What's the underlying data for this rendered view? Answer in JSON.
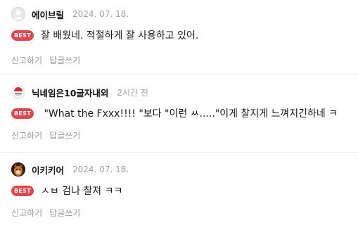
{
  "comments": [
    {
      "author": "에이브릴",
      "date": "2024. 07. 18.",
      "badge": "BEST",
      "text": "잘 배웠네. 적절하게 잘 사용하고 있어.",
      "actions": [
        "신고하기",
        "답글쓰기"
      ],
      "avatar_icon": "default-user-icon"
    },
    {
      "author": "닉네임은10글자내외",
      "date": "2시간 전",
      "badge": "BEST",
      "text": " \"What the Fxxx!!!! \"보다 \"이런 ㅆ.....\"이게 찰지게 느껴지긴하네 ㅋ",
      "actions": [
        "신고하기",
        "답글쓰기"
      ],
      "avatar_icon": "profile-logo-icon"
    },
    {
      "author": "이키키어",
      "date": "2024. 07. 18.",
      "badge": "BEST",
      "text": "ㅅㅂ 검나 찰져 ㅋㅋ",
      "actions": [
        "신고하기",
        "답글쓰기"
      ],
      "avatar_icon": "animal-photo-icon"
    }
  ],
  "colors": {
    "badge": "#e0464d",
    "muted": "#9a9a9a",
    "divider": "#ececec"
  }
}
